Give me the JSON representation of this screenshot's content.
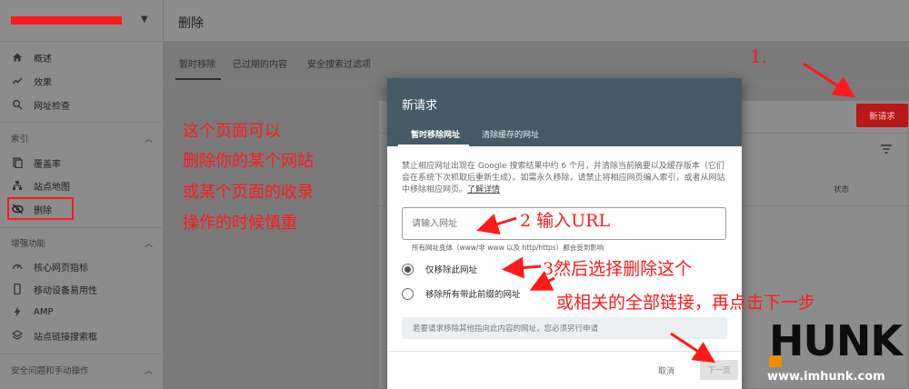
{
  "header": {
    "page_title": "删除"
  },
  "main_tabs": [
    {
      "label": "暂时移除"
    },
    {
      "label": "已过期的内容"
    },
    {
      "label": "安全搜索过滤项"
    }
  ],
  "sidebar": {
    "items_top": [
      {
        "icon": "home-icon",
        "label": "概述"
      },
      {
        "icon": "trending-icon",
        "label": "效果"
      },
      {
        "icon": "search-icon",
        "label": "网址检查"
      }
    ],
    "section_index": "索引",
    "items_index": [
      {
        "icon": "document-icon",
        "label": "覆盖率"
      },
      {
        "icon": "sitemap-icon",
        "label": "站点地图"
      },
      {
        "icon": "eye-off-icon",
        "label": "删除"
      }
    ],
    "section_enhance": "增强功能",
    "items_enhance": [
      {
        "icon": "gauge-icon",
        "label": "核心网页指标"
      },
      {
        "icon": "phone-icon",
        "label": "移动设备易用性"
      },
      {
        "icon": "bolt-icon",
        "label": "AMP"
      },
      {
        "icon": "layers-icon",
        "label": "站点链接搜索框"
      }
    ],
    "section_security": "安全问题和手动操作"
  },
  "background": {
    "new_request_button": "新请求",
    "status_column": "状态"
  },
  "dialog": {
    "title": "新请求",
    "tabs": [
      {
        "label": "暂时移除网址"
      },
      {
        "label": "清除缓存的网址"
      }
    ],
    "description": "禁止相应网址出现在 Google 搜索结果中约 6 个月，并清除当前摘要以及缓存版本（它们会在系统下次抓取后重新生成）。如需永久移除，请禁止将相应网页编入索引，或者从网站中移除相应网页。",
    "learn_more": "了解详情",
    "url_placeholder": "请输入网址",
    "helper": "所有网址变体（www/非 www 以及 http/https）都会受到影响",
    "radio_options": [
      {
        "label": "仅移除此网址",
        "checked": true
      },
      {
        "label": "移除所有带此前缀的网址",
        "checked": false
      }
    ],
    "info": "若要请求移除其他指向此内容的网址，您必须另行申请",
    "cancel": "取消",
    "next": "下一页"
  },
  "annotations": {
    "step1": "1.",
    "left_note_lines": [
      "这个页面可以",
      "删除你的某个网站",
      "或某个页面的收录",
      "操作的时候慎重"
    ],
    "step2": "2 输入URL",
    "step3_line1": "3然后选择删除这个",
    "step3_line2": "或相关的全部链接，再点击下一步"
  },
  "watermark": {
    "logo_text": "HUNK",
    "url": "www.imhunk.com"
  },
  "colors": {
    "dialog_header": "#455a64",
    "annotation_red": "#ff1a1a",
    "new_request_red": "#b71818"
  }
}
